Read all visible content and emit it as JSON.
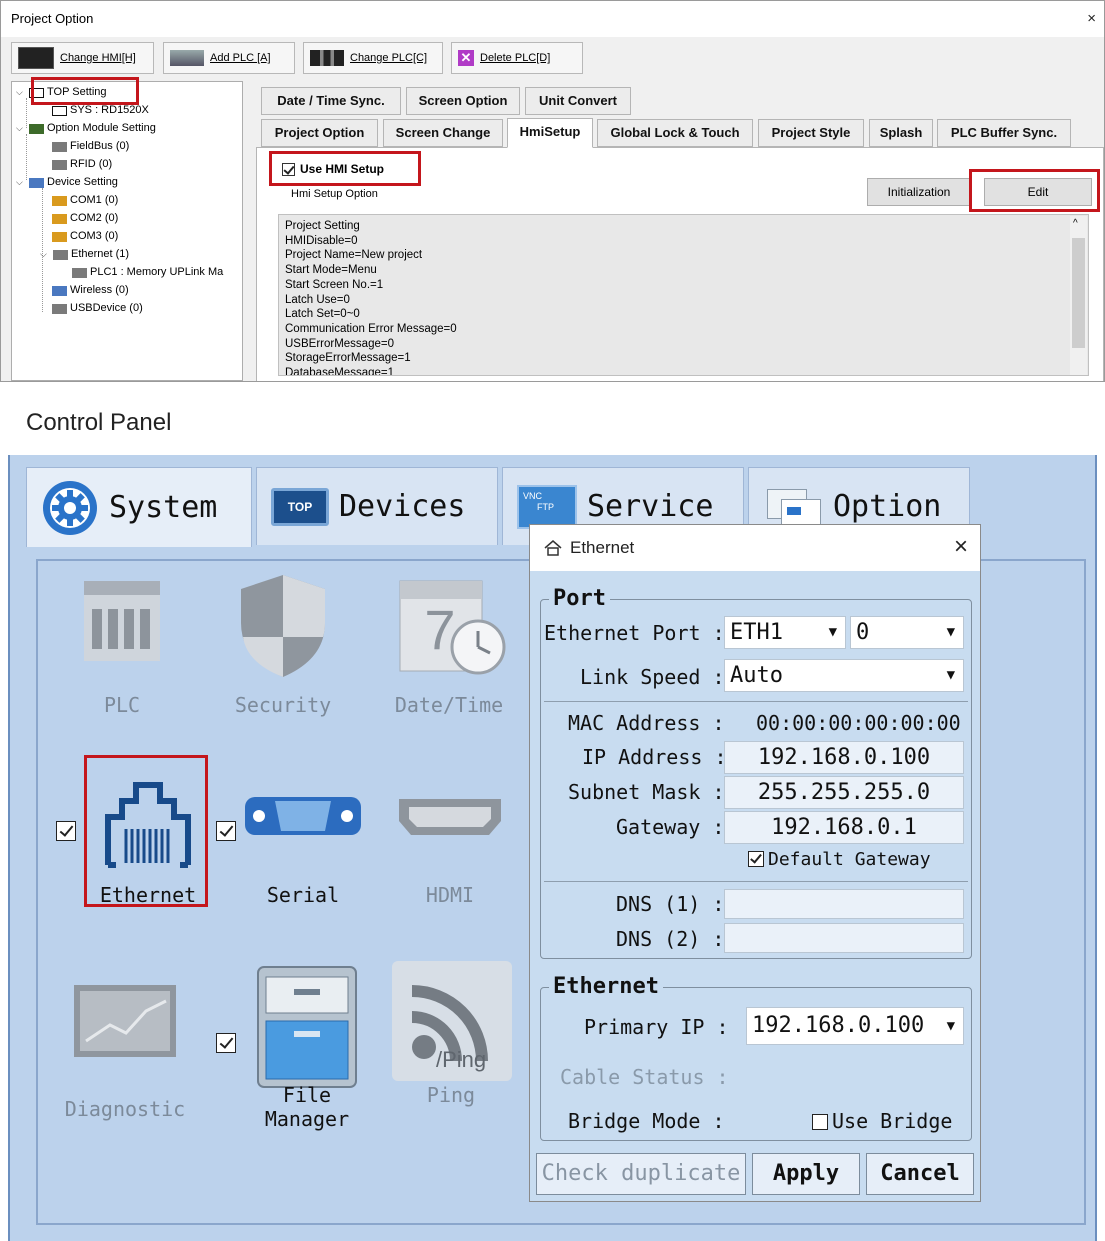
{
  "project_option": {
    "title": "Project Option",
    "close": "×",
    "toolbar": [
      "Change HMI[H]",
      "Add PLC [A]",
      "Change PLC[C]",
      "Delete PLC[D]"
    ],
    "tree": [
      "TOP Setting",
      "SYS : RD1520X",
      "Option Module Setting",
      "FieldBus (0)",
      "RFID (0)",
      "Device Setting",
      "COM1 (0)",
      "COM2 (0)",
      "COM3 (0)",
      "Ethernet (1)",
      "PLC1 : Memory UPLink Ma",
      "Wireless (0)",
      "USBDevice (0)"
    ],
    "tabs_row1": [
      "Date / Time Sync.",
      "Screen Option",
      "Unit Convert"
    ],
    "tabs_row2": [
      "Project Option",
      "Screen Change",
      "HmiSetup",
      "Global Lock & Touch",
      "Project Style",
      "Splash",
      "PLC Buffer Sync."
    ],
    "use_hmi_setup": "Use HMI Setup",
    "hmi_setup_option": "Hmi Setup Option",
    "init_button": "Initialization",
    "edit_button": "Edit",
    "settings_lines": [
      "Project Setting",
      "HMIDisable=0",
      "Project Name=New project",
      "Start Mode=Menu",
      "Start Screen No.=1",
      "Latch Use=0",
      "Latch Set=0~0",
      "Communication Error Message=0",
      "USBErrorMessage=0",
      "StorageErrorMessage=1",
      "DatabaseMessage=1"
    ]
  },
  "control_panel": {
    "title": "Control Panel",
    "tabs": [
      "System",
      "Devices",
      "Service",
      "Option"
    ],
    "service_badge_top": "VNC",
    "service_badge_bottom": "FTP",
    "devices_badge": "TOP",
    "icons": {
      "plc": "PLC",
      "security": "Security",
      "datetime": "Date/Time",
      "ethernet": "Ethernet",
      "serial": "Serial",
      "hdmi": "HDMI",
      "diagnostic": "Diagnostic",
      "file_manager_1": "File",
      "file_manager_2": "Manager",
      "ping": "Ping",
      "ping_overlay": "/Ping",
      "calendar_num": "7"
    }
  },
  "ethernet_dialog": {
    "title": "Ethernet",
    "close": "×",
    "port_group": "Port",
    "ethernet_port_label": "Ethernet Port :",
    "ethernet_port_value": "ETH1",
    "port_index_value": "0",
    "link_speed_label": "Link Speed :",
    "link_speed_value": "Auto",
    "mac_label": "MAC Address :",
    "mac_value": "00:00:00:00:00:00",
    "ip_label": "IP Address :",
    "ip_value": "192.168.0.100",
    "subnet_label": "Subnet Mask :",
    "subnet_value": "255.255.255.0",
    "gateway_label": "Gateway :",
    "gateway_value": "192.168.0.1",
    "default_gateway": "Default Gateway",
    "dns1_label": "DNS (1) :",
    "dns1_value": "",
    "dns2_label": "DNS (2) :",
    "dns2_value": "",
    "ethernet_group": "Ethernet",
    "primary_ip_label": "Primary IP :",
    "primary_ip_value": "192.168.0.100",
    "cable_status_label": "Cable Status :",
    "bridge_mode_label": "Bridge Mode :",
    "use_bridge": "Use Bridge",
    "check_duplicate": "Check duplicate",
    "apply": "Apply",
    "cancel": "Cancel"
  },
  "colors": {
    "highlight": "#c4161c",
    "panel_bg": "#bcd2ec",
    "dialog_bg": "#c8dcf0",
    "system_icon": "#2a73c9"
  }
}
